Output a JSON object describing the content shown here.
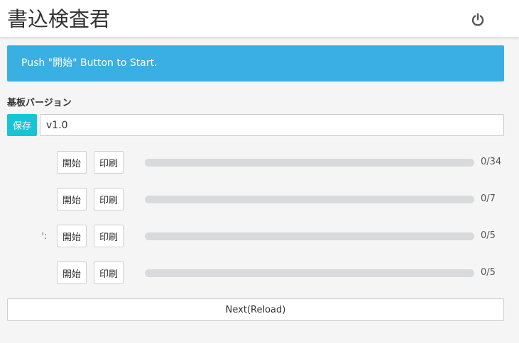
{
  "header": {
    "title": "書込検査君",
    "power_icon": "power-icon"
  },
  "alert": {
    "message": "Push \"開始\" Button to Start."
  },
  "board_version": {
    "label": "基板バージョン",
    "save_label": "保存",
    "value": "v1.0"
  },
  "rows": [
    {
      "label": "",
      "start_label": "開始",
      "print_label": "印刷",
      "count": "0/34",
      "progress": 0
    },
    {
      "label": "",
      "start_label": "開始",
      "print_label": "印刷",
      "count": "0/7",
      "progress": 0
    },
    {
      "label": "':",
      "start_label": "開始",
      "print_label": "印刷",
      "count": "0/5",
      "progress": 0
    },
    {
      "label": "",
      "start_label": "開始",
      "print_label": "印刷",
      "count": "0/5",
      "progress": 0
    }
  ],
  "footer": {
    "next_label": "Next(Reload)"
  },
  "colors": {
    "accent": "#3aafe3",
    "save": "#17c4d6",
    "progress_track": "#d9dadb"
  }
}
